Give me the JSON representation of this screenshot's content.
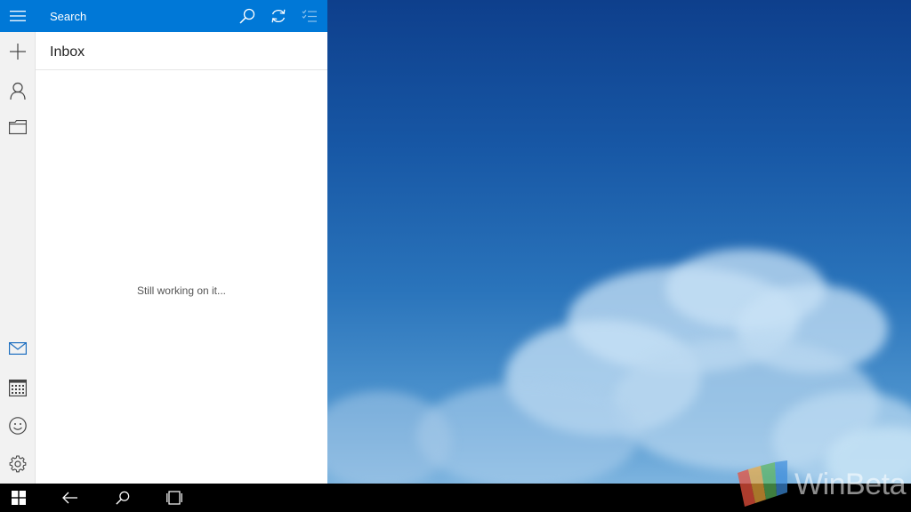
{
  "search": {
    "placeholder": "Search"
  },
  "folder": {
    "title": "Inbox"
  },
  "status": {
    "message": "Still working on it..."
  },
  "watermark": {
    "text": "WinBeta"
  },
  "colors": {
    "accent": "#0078d7",
    "rail": "#f2f2f2",
    "taskbar": "#000000"
  },
  "rail_top": [
    "hamburger-icon",
    "plus-icon",
    "person-icon",
    "folder-icon"
  ],
  "rail_bottom": [
    "mail-icon",
    "calendar-icon",
    "smiley-icon",
    "gear-icon"
  ],
  "topbar_icons": [
    "search-icon",
    "sync-icon",
    "select-icon"
  ],
  "taskbar_icons": [
    "windows-logo-icon",
    "back-arrow-icon",
    "search-icon",
    "task-view-icon"
  ]
}
